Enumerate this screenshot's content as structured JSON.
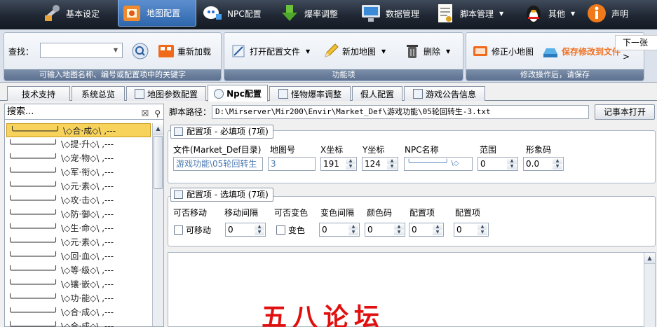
{
  "nav": {
    "items": [
      {
        "label": "基本设定",
        "icon": "wrench-icon"
      },
      {
        "label": "地图配置",
        "icon": "map-icon"
      },
      {
        "label": "NPC配置",
        "icon": "npc-icon"
      },
      {
        "label": "爆率调整",
        "icon": "download-arrow-icon"
      },
      {
        "label": "数据管理",
        "icon": "monitor-icon"
      },
      {
        "label": "脚本管理",
        "icon": "document-icon"
      },
      {
        "label": "其他",
        "icon": "penguin-icon"
      },
      {
        "label": "声明",
        "icon": "info-icon"
      }
    ]
  },
  "ribbon": {
    "search_label": "查找：",
    "reload_label": "重新加载",
    "search_caption": "可输入地图名称、编号或配置项中的关键字",
    "open_config_label": "打开配置文件",
    "new_map_label": "新加地图",
    "delete_label": "删除",
    "function_caption": "功能项",
    "fix_minimap_label": "修正小地图",
    "save_label": "保存修改到文件",
    "modify_caption": "修改操作后，请保存",
    "next_label": "下一张 >"
  },
  "tabs": [
    {
      "label": "技术支持"
    },
    {
      "label": "系统总览"
    },
    {
      "label": "地图参数配置"
    },
    {
      "label": "Npc配置"
    },
    {
      "label": "怪物爆率调整"
    },
    {
      "label": "假人配置"
    },
    {
      "label": "游戏公告信息"
    }
  ],
  "left_panel": {
    "search_placeholder": "搜索...",
    "items": [
      "╰────────╯ \\◇合·成◇\\ ,---",
      "╰────────╯ \\◇提·升◇\\ ,---",
      "╰────────╯ \\◇宠·物◇\\ ,---",
      "╰────────╯ \\◇军·衔◇\\ ,---",
      "╰────────╯ \\◇元·素◇\\ ,---",
      "╰────────╯ \\◇攻·击◇\\ ,---",
      "╰────────╯ \\◇防·御◇\\ ,---",
      "╰────────╯ \\◇生·命◇\\ ,---",
      "╰────────╯ \\◇元·素◇\\ ,---",
      "╰────────╯ \\◇回·血◇\\ ,---",
      "╰────────╯ \\◇等·级◇\\ ,---",
      "╰────────╯ \\◇镶·嵌◇\\ ,---",
      "╰────────╯ \\◇功·能◇\\ ,---",
      "╰────────╯ \\◇合·成◇\\ ,---",
      "╰────────╯ \\◇合·成◇\\ ,---"
    ]
  },
  "main": {
    "path_label": "脚本路径：",
    "path_value": "D:\\Mirserver\\Mir200\\Envir\\Market_Def\\游戏功能\\05轮回转生-3.txt",
    "notepad_button": "记事本打开",
    "required": {
      "title": "配置项 - 必填项 (7项)",
      "labels": [
        "文件(Market_Def目录)",
        "地图号",
        "X坐标",
        "Y坐标",
        "NPC名称",
        "范围",
        "形象码"
      ],
      "file_value": "游戏功能\\05轮回转生",
      "map_value": "3",
      "x_value": "191",
      "y_value": "124",
      "npc_value": "╰────────╯ \\◇",
      "range_value": "0",
      "appearance_value": "0.0"
    },
    "optional": {
      "title": "配置项 - 选填项 (7项)",
      "labels": [
        "可否移动",
        "移动间隔",
        "可否变色",
        "变色间隔",
        "颜色码",
        "配置项",
        "配置项"
      ],
      "movable_label": "可移动",
      "move_interval": "0",
      "color_label": "变色",
      "color_interval": "0",
      "color_code": "0",
      "config1": "0",
      "config2": "0"
    },
    "watermark": "五八论坛"
  }
}
